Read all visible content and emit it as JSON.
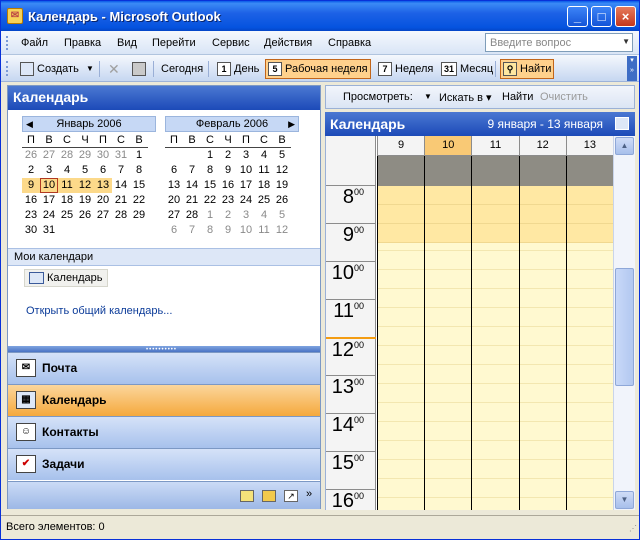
{
  "window": {
    "title": "Календарь - Microsoft Outlook",
    "minimize": "_",
    "maximize": "□",
    "close": "×"
  },
  "menu": [
    "Файл",
    "Правка",
    "Вид",
    "Перейти",
    "Сервис",
    "Действия",
    "Справка"
  ],
  "ask": {
    "placeholder": "Введите вопрос"
  },
  "toolbar": {
    "create": "Создать",
    "today": "Сегодня",
    "day": "День",
    "day_num": "1",
    "workweek": "Рабочая неделя",
    "workweek_num": "5",
    "week": "Неделя",
    "week_num": "7",
    "month": "Месяц",
    "month_num": "31",
    "find": "Найти"
  },
  "nav": {
    "title": "Календарь",
    "cal1": {
      "month": "Январь 2006",
      "dows": [
        "П",
        "В",
        "С",
        "Ч",
        "П",
        "С",
        "В"
      ],
      "days": [
        [
          "26",
          "dim"
        ],
        [
          "27",
          "dim"
        ],
        [
          "28",
          "dim"
        ],
        [
          "29",
          "dim"
        ],
        [
          "30",
          "dim"
        ],
        [
          "31",
          "dim"
        ],
        [
          "1",
          ""
        ],
        [
          "2",
          ""
        ],
        [
          "3",
          ""
        ],
        [
          "4",
          ""
        ],
        [
          "5",
          ""
        ],
        [
          "6",
          ""
        ],
        [
          "7",
          ""
        ],
        [
          "8",
          ""
        ],
        [
          "9",
          "sel"
        ],
        [
          "10",
          "sel today"
        ],
        [
          "11",
          "sel"
        ],
        [
          "12",
          "sel"
        ],
        [
          "13",
          "sel"
        ],
        [
          "14",
          ""
        ],
        [
          "15",
          ""
        ],
        [
          "16",
          ""
        ],
        [
          "17",
          ""
        ],
        [
          "18",
          ""
        ],
        [
          "19",
          ""
        ],
        [
          "20",
          ""
        ],
        [
          "21",
          ""
        ],
        [
          "22",
          ""
        ],
        [
          "23",
          ""
        ],
        [
          "24",
          ""
        ],
        [
          "25",
          ""
        ],
        [
          "26",
          ""
        ],
        [
          "27",
          ""
        ],
        [
          "28",
          ""
        ],
        [
          "29",
          ""
        ],
        [
          "30",
          ""
        ],
        [
          "31",
          ""
        ]
      ]
    },
    "cal2": {
      "month": "Февраль 2006",
      "dows": [
        "П",
        "В",
        "С",
        "Ч",
        "П",
        "С",
        "В"
      ],
      "days": [
        [
          "",
          ""
        ],
        [
          "",
          ""
        ],
        [
          "1",
          ""
        ],
        [
          "2",
          ""
        ],
        [
          "3",
          ""
        ],
        [
          "4",
          ""
        ],
        [
          "5",
          ""
        ],
        [
          "6",
          ""
        ],
        [
          "7",
          ""
        ],
        [
          "8",
          ""
        ],
        [
          "9",
          ""
        ],
        [
          "10",
          ""
        ],
        [
          "11",
          ""
        ],
        [
          "12",
          ""
        ],
        [
          "13",
          ""
        ],
        [
          "14",
          ""
        ],
        [
          "15",
          ""
        ],
        [
          "16",
          ""
        ],
        [
          "17",
          ""
        ],
        [
          "18",
          ""
        ],
        [
          "19",
          ""
        ],
        [
          "20",
          ""
        ],
        [
          "21",
          ""
        ],
        [
          "22",
          ""
        ],
        [
          "23",
          ""
        ],
        [
          "24",
          ""
        ],
        [
          "25",
          ""
        ],
        [
          "26",
          ""
        ],
        [
          "27",
          ""
        ],
        [
          "28",
          ""
        ],
        [
          "1",
          "dim"
        ],
        [
          "2",
          "dim"
        ],
        [
          "3",
          "dim"
        ],
        [
          "4",
          "dim"
        ],
        [
          "5",
          "dim"
        ],
        [
          "6",
          "dim"
        ],
        [
          "7",
          "dim"
        ],
        [
          "8",
          "dim"
        ],
        [
          "9",
          "dim"
        ],
        [
          "10",
          "dim"
        ],
        [
          "11",
          "dim"
        ],
        [
          "12",
          "dim"
        ]
      ]
    },
    "my_calendars": "Мои календари",
    "calendar_item": "Календарь",
    "open_shared": "Открыть общий календарь...",
    "buttons": [
      "Почта",
      "Календарь",
      "Контакты",
      "Задачи"
    ]
  },
  "view": {
    "show_label": "Просмотреть:",
    "search_in": "Искать в ▾",
    "find": "Найти",
    "clear": "Очистить"
  },
  "calendar": {
    "title": "Календарь",
    "range": "9 января - 13 января",
    "days": [
      "9",
      "10",
      "11",
      "12",
      "13"
    ],
    "current_day": "10",
    "hours": [
      "8",
      "9",
      "10",
      "11",
      "12",
      "13",
      "14",
      "15",
      "16"
    ],
    "minutes": "00",
    "current_hour": "12"
  },
  "status": {
    "text": "Всего элементов: 0"
  },
  "colors": {
    "accent": "#1c4ab8",
    "selected": "#f5a93d",
    "work_hours": "#fff9d0"
  }
}
